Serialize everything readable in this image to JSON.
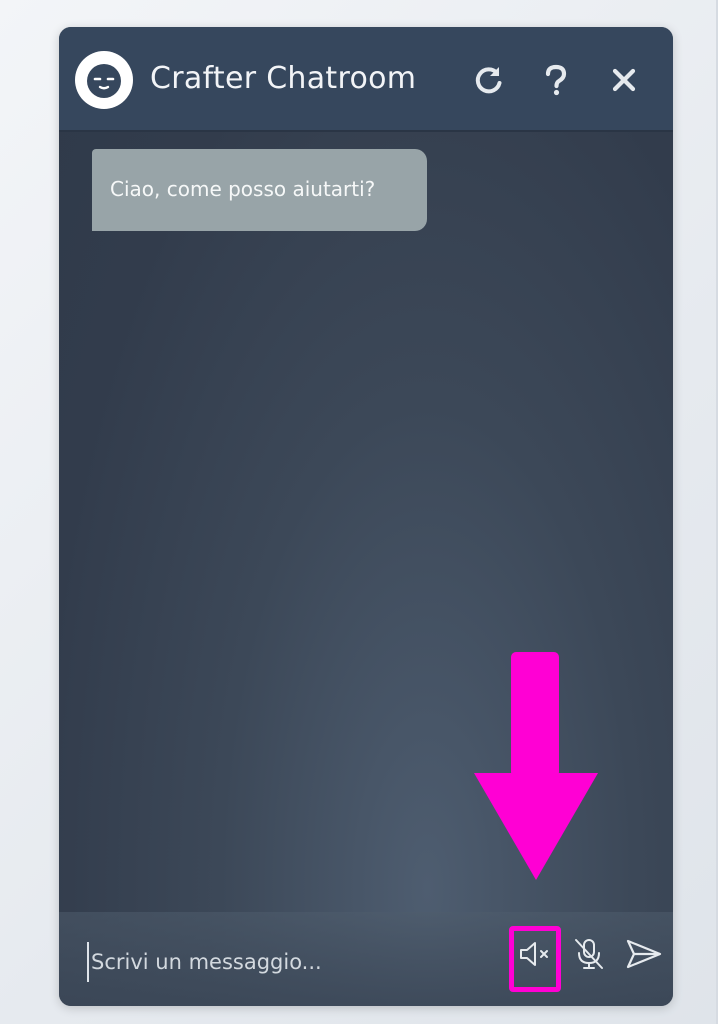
{
  "header": {
    "title": "Crafter Chatroom",
    "refresh_icon": "refresh-icon",
    "help_icon": "help-icon",
    "close_icon": "close-icon"
  },
  "messages": [
    {
      "sender": "bot",
      "text": "Ciao, come posso aiutarti?"
    }
  ],
  "input": {
    "placeholder": "Scrivi un messaggio...",
    "value": ""
  },
  "controls": {
    "mute_icon": "speaker-muted-icon",
    "mic_icon": "microphone-off-icon",
    "send_icon": "send-icon"
  },
  "colors": {
    "header_bg": "#36475d",
    "bubble_bg": "#98a4a8",
    "annotation": "#ff00d4"
  }
}
